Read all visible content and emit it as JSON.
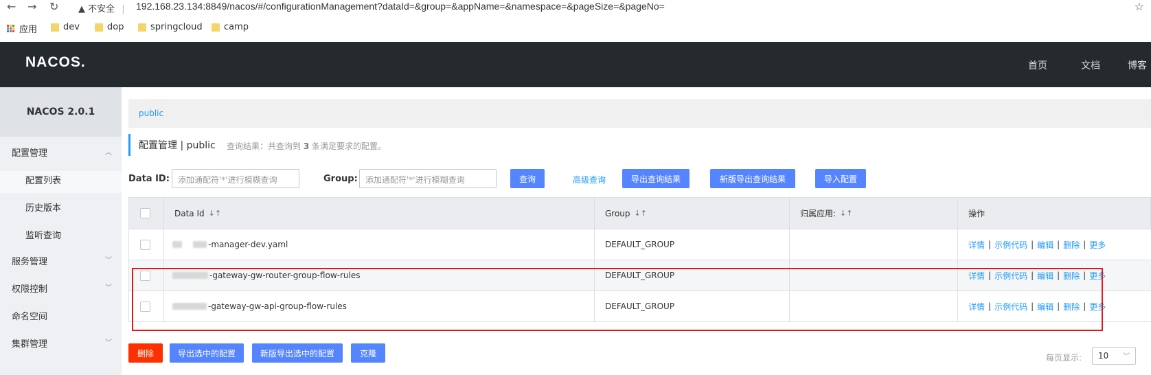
{
  "browser": {
    "insecure_label": "不安全",
    "url": "192.168.23.134:8849/nacos/#/configurationManagement?dataId=&group=&appName=&namespace=&pageSize=&pageNo=",
    "bookmarks": [
      "应用",
      "dev",
      "dop",
      "springcloud",
      "camp"
    ]
  },
  "header": {
    "logo": "NACOS.",
    "nav": [
      "首页",
      "文档",
      "博客"
    ]
  },
  "sidebar": {
    "version": "NACOS 2.0.1",
    "items": [
      {
        "label": "配置管理"
      },
      {
        "label": "配置列表"
      },
      {
        "label": "历史版本"
      },
      {
        "label": "监听查询"
      },
      {
        "label": "服务管理"
      },
      {
        "label": "权限控制"
      },
      {
        "label": "命名空间"
      },
      {
        "label": "集群管理"
      }
    ]
  },
  "main": {
    "namespace_tab": "public",
    "title": "配置管理 | public",
    "result_prefix": "查询结果：共查询到",
    "result_count": "3",
    "result_suffix": "条满足要求的配置。",
    "filters": {
      "dataid_label": "Data ID:",
      "dataid_placeholder": "添加通配符'*'进行模糊查询",
      "group_label": "Group:",
      "group_placeholder": "添加通配符'*'进行模糊查询"
    },
    "buttons": {
      "query": "查询",
      "advanced": "高级查询",
      "export": "导出查询结果",
      "new_export": "新版导出查询结果",
      "import": "导入配置"
    },
    "table": {
      "columns": [
        "Data Id",
        "Group",
        "归属应用:",
        "操作"
      ],
      "rows": [
        {
          "data_id": "-manager-dev.yaml",
          "group": "DEFAULT_GROUP",
          "app": ""
        },
        {
          "data_id": "-gateway-gw-router-group-flow-rules",
          "group": "DEFAULT_GROUP",
          "app": ""
        },
        {
          "data_id": "-gateway-gw-api-group-flow-rules",
          "group": "DEFAULT_GROUP",
          "app": ""
        }
      ],
      "ops": [
        "详情",
        "示例代码",
        "编辑",
        "删除",
        "更多"
      ]
    },
    "bottom": {
      "delete": "删除",
      "export_selected": "导出选中的配置",
      "new_export_selected": "新版导出选中的配置",
      "clone": "克隆",
      "page_size_label": "每页显示:",
      "page_size": "10"
    }
  },
  "colors": {
    "primary": "#5584ff",
    "link": "#209bfa",
    "danger": "#ff3000",
    "header_bg": "#252a2f",
    "highlight": "#e3161a"
  }
}
